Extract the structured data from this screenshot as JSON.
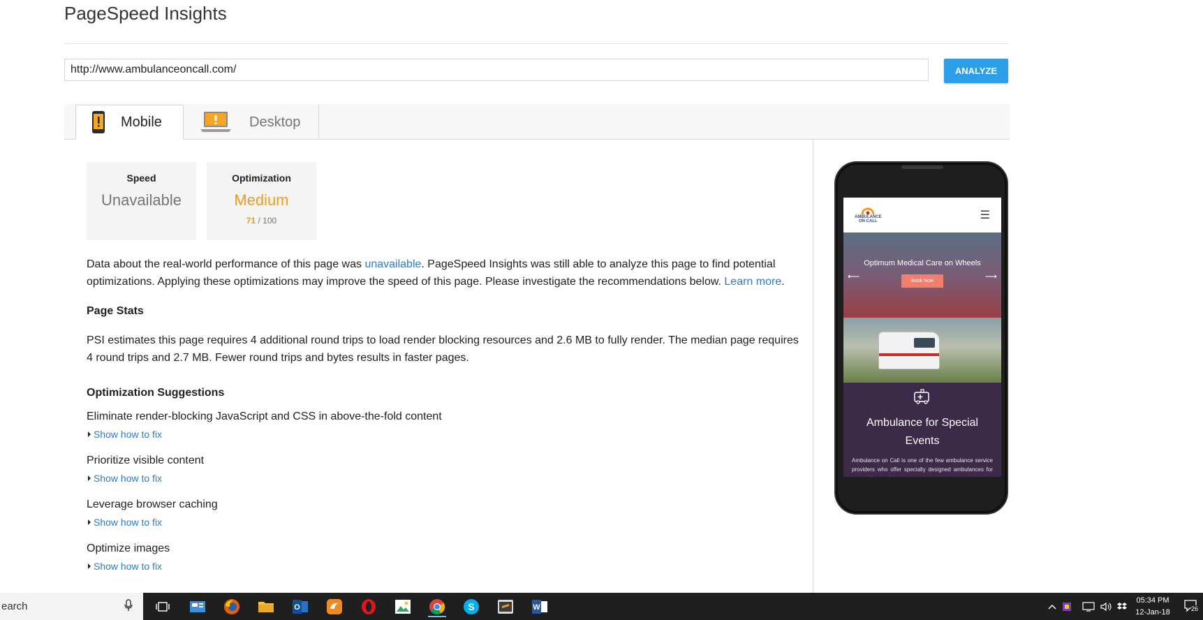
{
  "header": {
    "title": "PageSpeed Insights"
  },
  "search": {
    "url": "http://www.ambulanceoncall.com/",
    "analyze_label": "ANALYZE"
  },
  "tabs": [
    {
      "label": "Mobile",
      "active": true
    },
    {
      "label": "Desktop",
      "active": false
    }
  ],
  "scores": {
    "speed": {
      "label": "Speed",
      "value": "Unavailable"
    },
    "optimization": {
      "label": "Optimization",
      "value": "Medium",
      "score": "71",
      "max": "/ 100"
    }
  },
  "summary": {
    "part1": "Data about the real-world performance of this page was ",
    "link1": "unavailable",
    "part2": ". PageSpeed Insights was still able to analyze this page to find potential optimizations. Applying these optimizations may improve the speed of this page. Please investigate the recommendations below. ",
    "link2": "Learn more",
    "part3": "."
  },
  "page_stats": {
    "heading": "Page Stats",
    "text": "PSI estimates this page requires 4 additional round trips to load render blocking resources and 2.6 MB to fully render. The median page requires 4 round trips and 2.7 MB. Fewer round trips and bytes results in faster pages."
  },
  "optimization_suggestions": {
    "heading": "Optimization Suggestions",
    "fix_label": "Show how to fix",
    "rules": [
      "Eliminate render-blocking JavaScript and CSS in above-the-fold content",
      "Prioritize visible content",
      "Leverage browser caching",
      "Optimize images"
    ]
  },
  "phone_preview": {
    "logo_line1": "AMBULANCE",
    "logo_line2": "ON CALL",
    "hero_text": "Optimum Medical Care on Wheels",
    "hero_button": "Book Now",
    "section_title_line1": "Ambulance for Special",
    "section_title_line2": "Events",
    "section_text": "Ambulance on Call is one of the few ambulance service providers who offer specially designed ambulances for corporate events."
  },
  "taskbar": {
    "search_placeholder": "earch",
    "time": "05:34 PM",
    "date": "12-Jan-18",
    "notifications": "26"
  },
  "colors": {
    "accent": "#2e9ee8",
    "link": "#2b7bcc",
    "medium": "#f39a1e",
    "phone_section": "#3b2a48"
  }
}
